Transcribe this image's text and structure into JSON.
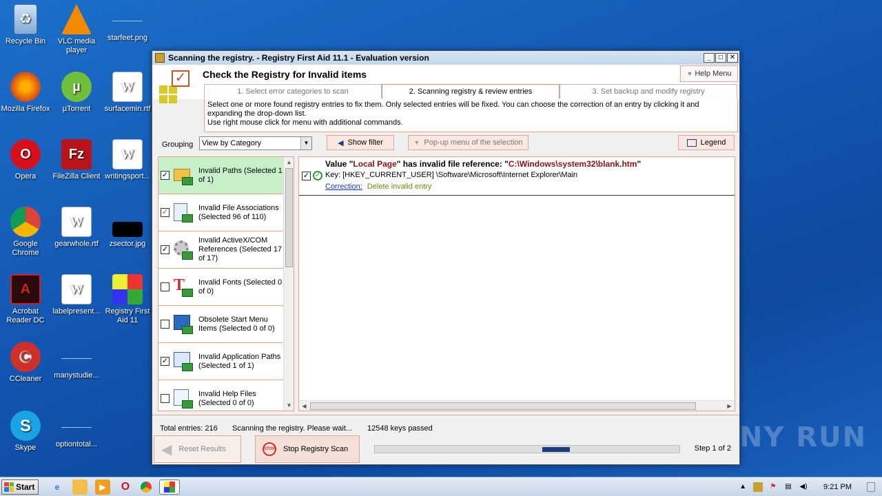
{
  "desktop": {
    "icons": [
      {
        "label": "Recycle Bin"
      },
      {
        "label": "VLC media player"
      },
      {
        "label": "starfeet.png"
      },
      {
        "label": "Mozilla Firefox"
      },
      {
        "label": "µTorrent"
      },
      {
        "label": "surfacemin.rtf"
      },
      {
        "label": "Opera"
      },
      {
        "label": "FileZilla Client"
      },
      {
        "label": "writingsport..."
      },
      {
        "label": "Google Chrome"
      },
      {
        "label": "gearwhole.rtf"
      },
      {
        "label": "zsector.jpg"
      },
      {
        "label": "Acrobat Reader DC"
      },
      {
        "label": "labelpresent..."
      },
      {
        "label": "Registry First Aid 11"
      },
      {
        "label": "CCleaner"
      },
      {
        "label": "manystudie..."
      },
      {
        "label": "Skype"
      },
      {
        "label": "optiontotal..."
      }
    ]
  },
  "window": {
    "title": "Scanning the registry. - Registry First Aid 11.1 - Evaluation version",
    "controls": {
      "minimize": "_",
      "maximize": "□",
      "close": "✕"
    },
    "page_title": "Check the Registry for Invalid items",
    "help_menu": "Help Menu",
    "tabs": [
      {
        "label": "1. Select error categories to scan"
      },
      {
        "label": "2. Scanning registry & review entries"
      },
      {
        "label": "3. Set backup and modify registry"
      }
    ],
    "description_line1": "Select one or more found registry entries to fix them. Only selected entries will be fixed. You can choose the correction of an entry by clicking it and expanding the drop-down list.",
    "description_line2": "Use right mouse click for menu with additional commands.",
    "grouping_label": "Grouping",
    "grouping_value": "View by Category",
    "show_filter": "Show filter",
    "popup_menu": "Pop-up menu of the selection",
    "legend": "Legend",
    "categories": [
      {
        "label": "Invalid Paths (Selected 1 of 1)",
        "checked": true
      },
      {
        "label": "Invalid File Associations (Selected 96 of 110)",
        "checked": true
      },
      {
        "label": "Invalid ActiveX/COM References (Selected 17 of 17)",
        "checked": true
      },
      {
        "label": "Invalid Fonts (Selected 0 of 0)",
        "checked": false
      },
      {
        "label": "Obsolete Start Menu Items (Selected 0 of 0)",
        "checked": false
      },
      {
        "label": "Invalid Application Paths (Selected 1 of 1)",
        "checked": true
      },
      {
        "label": "Invalid Help Files (Selected 0 of 0)",
        "checked": false
      }
    ],
    "entry": {
      "title_prefix": "Value \"",
      "value_name": "Local Page",
      "title_mid": "\" has invalid file reference: \"",
      "file_ref": "C:\\Windows\\system32\\blank.htm",
      "title_suffix": "\"",
      "key": "Key: [HKEY_CURRENT_USER] \\Software\\Microsoft\\Internet Explorer\\Main",
      "correction_label": "Correction:",
      "correction_value": "Delete invalid entry"
    },
    "status": {
      "total_entries": "Total entries: 216",
      "scanning": "Scanning the registry. Please wait...",
      "keys_passed": "12548 keys passed"
    },
    "reset_results": "Reset Results",
    "stop_scan": "Stop Registry Scan",
    "stop_icon_text": "STOP",
    "progress": 0.09,
    "step_label": "Step 1 of 2"
  },
  "taskbar": {
    "start": "Start",
    "clock": "9:21 PM"
  },
  "watermark": "ANY RUN"
}
